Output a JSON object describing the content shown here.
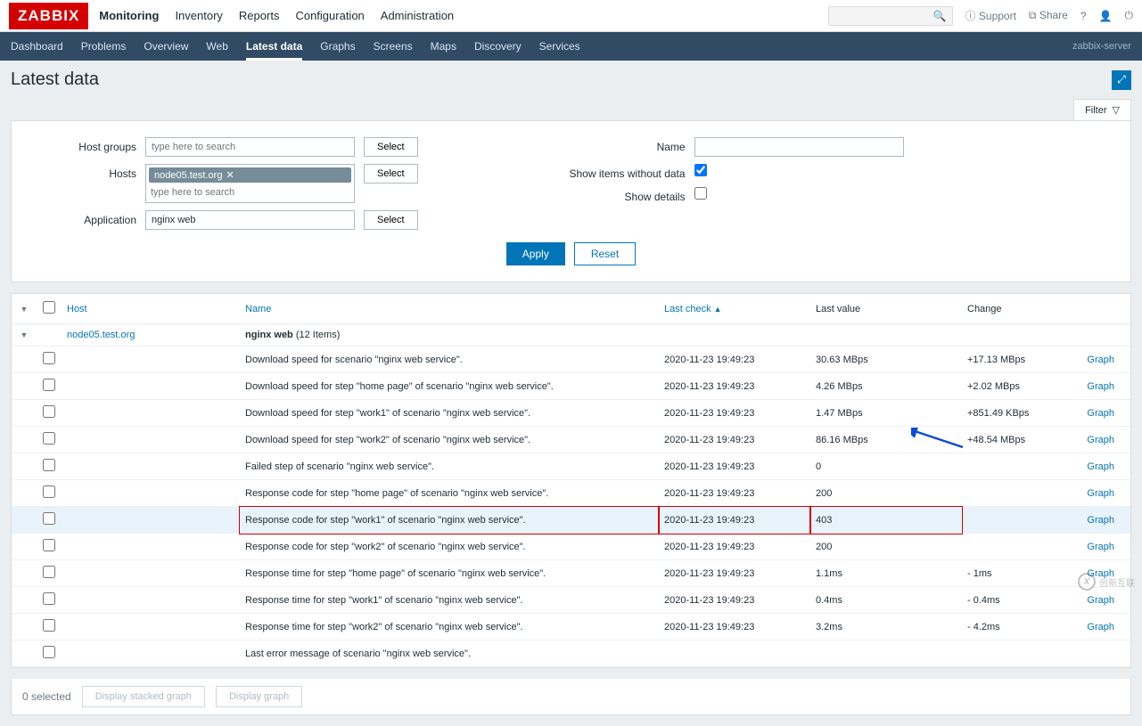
{
  "logo": "ZABBIX",
  "topnav": [
    "Monitoring",
    "Inventory",
    "Reports",
    "Configuration",
    "Administration"
  ],
  "topnav_selected": 0,
  "topright": {
    "support": "Support",
    "share": "Share"
  },
  "subnav": [
    "Dashboard",
    "Problems",
    "Overview",
    "Web",
    "Latest data",
    "Graphs",
    "Screens",
    "Maps",
    "Discovery",
    "Services"
  ],
  "subnav_selected": 4,
  "server_label": "zabbix-server",
  "page_title": "Latest data",
  "filter_tab": "Filter",
  "filter": {
    "hostgroups_label": "Host groups",
    "hostgroups_placeholder": "type here to search",
    "hosts_label": "Hosts",
    "hosts_tag": "node05.test.org",
    "hosts_placeholder": "type here to search",
    "application_label": "Application",
    "application_value": "nginx web",
    "name_label": "Name",
    "show_no_data_label": "Show items without data",
    "show_no_data": true,
    "show_details_label": "Show details",
    "show_details": false,
    "select_btn": "Select",
    "apply": "Apply",
    "reset": "Reset"
  },
  "columns": {
    "host": "Host",
    "name": "Name",
    "last_check": "Last check",
    "last_value": "Last value",
    "change": "Change"
  },
  "group": {
    "host": "node05.test.org",
    "app": "nginx web",
    "count": "(12 Items)"
  },
  "rows": [
    {
      "name": "Download speed for scenario \"nginx web service\".",
      "check": "2020-11-23 19:49:23",
      "value": "30.63 MBps",
      "change": "+17.13 MBps",
      "action": "Graph"
    },
    {
      "name": "Download speed for step \"home page\" of scenario \"nginx web service\".",
      "check": "2020-11-23 19:49:23",
      "value": "4.26 MBps",
      "change": "+2.02 MBps",
      "action": "Graph"
    },
    {
      "name": "Download speed for step \"work1\" of scenario \"nginx web service\".",
      "check": "2020-11-23 19:49:23",
      "value": "1.47 MBps",
      "change": "+851.49 KBps",
      "action": "Graph"
    },
    {
      "name": "Download speed for step \"work2\" of scenario \"nginx web service\".",
      "check": "2020-11-23 19:49:23",
      "value": "86.16 MBps",
      "change": "+48.54 MBps",
      "action": "Graph"
    },
    {
      "name": "Failed step of scenario \"nginx web service\".",
      "check": "2020-11-23 19:49:23",
      "value": "0",
      "change": "",
      "action": "Graph"
    },
    {
      "name": "Response code for step \"home page\" of scenario \"nginx web service\".",
      "check": "2020-11-23 19:49:23",
      "value": "200",
      "change": "",
      "action": "Graph"
    },
    {
      "name": "Response code for step \"work1\" of scenario \"nginx web service\".",
      "check": "2020-11-23 19:49:23",
      "value": "403",
      "change": "",
      "action": "Graph",
      "hl": true,
      "box": true
    },
    {
      "name": "Response code for step \"work2\" of scenario \"nginx web service\".",
      "check": "2020-11-23 19:49:23",
      "value": "200",
      "change": "",
      "action": "Graph"
    },
    {
      "name": "Response time for step \"home page\" of scenario \"nginx web service\".",
      "check": "2020-11-23 19:49:23",
      "value": "1.1ms",
      "change": "- 1ms",
      "action": "Graph"
    },
    {
      "name": "Response time for step \"work1\" of scenario \"nginx web service\".",
      "check": "2020-11-23 19:49:23",
      "value": "0.4ms",
      "change": "- 0.4ms",
      "action": "Graph"
    },
    {
      "name": "Response time for step \"work2\" of scenario \"nginx web service\".",
      "check": "2020-11-23 19:49:23",
      "value": "3.2ms",
      "change": "- 4.2ms",
      "action": "Graph"
    },
    {
      "name": "Last error message of scenario \"nginx web service\".",
      "check": "",
      "value": "",
      "change": "",
      "action": ""
    }
  ],
  "footer": {
    "selected": "0 selected",
    "stacked": "Display stacked graph",
    "graph": "Display graph"
  },
  "watermark": "创新互联"
}
